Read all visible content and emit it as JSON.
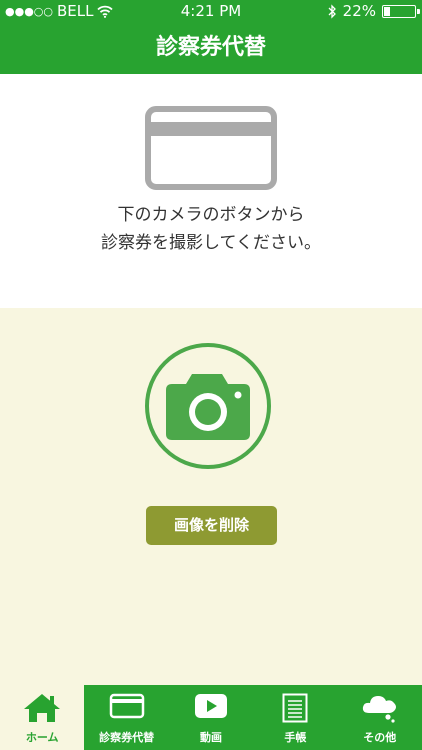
{
  "status": {
    "signal": "●●●○○",
    "carrier": "BELL",
    "time": "4:21 PM",
    "battery": "22%",
    "battery_level": 0.22
  },
  "header": {
    "title": "診察券代替"
  },
  "instructions": {
    "line1": "下のカメラのボタンから",
    "line2": "診察券を撮影してください。"
  },
  "actions": {
    "delete_label": "画像を削除"
  },
  "tabs": [
    {
      "label": "ホーム",
      "icon": "home-icon",
      "active": true
    },
    {
      "label": "診察券代替",
      "icon": "card-icon",
      "active": false
    },
    {
      "label": "動画",
      "icon": "video-icon",
      "active": false
    },
    {
      "label": "手帳",
      "icon": "notebook-icon",
      "active": false
    },
    {
      "label": "その他",
      "icon": "more-cloud-icon",
      "active": false
    }
  ],
  "colors": {
    "primary_green": "#28a330",
    "camera_green": "#4ca84a",
    "delete_olive": "#8e9a32",
    "background_cream": "#f8f6e0"
  }
}
